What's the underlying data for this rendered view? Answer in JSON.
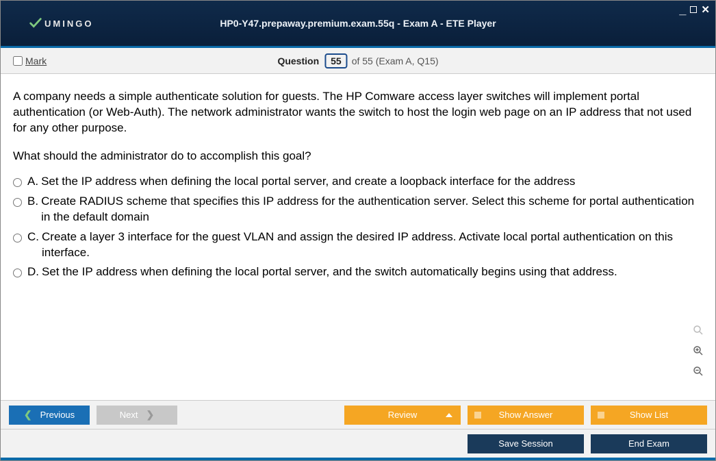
{
  "window": {
    "logo_text": "UMINGO",
    "title": "HP0-Y47.prepaway.premium.exam.55q - Exam A - ETE Player"
  },
  "header": {
    "mark_label": "Mark",
    "question_label": "Question",
    "current": "55",
    "of_text": "of 55 (Exam A, Q15)"
  },
  "question": {
    "text": "A company needs a simple authenticate solution for guests. The HP Comware access layer switches will implement portal authentication (or Web-Auth). The network administrator wants the switch to host the login web page on an IP address that not used for any other purpose.",
    "prompt": "What should the administrator do to accomplish this goal?",
    "options": [
      {
        "letter": "A.",
        "text": "Set the IP address when defining the local portal server, and create a loopback interface for the address"
      },
      {
        "letter": "B.",
        "text": "Create RADIUS scheme that specifies this IP address for the authentication server. Select this scheme for portal authentication in the default domain"
      },
      {
        "letter": "C.",
        "text": "Create a layer 3 interface for the guest VLAN and assign the desired IP address. Activate local portal authentication on this interface."
      },
      {
        "letter": "D.",
        "text": "Set the IP address when defining the local portal server, and the switch automatically begins using that address."
      }
    ]
  },
  "toolbar": {
    "previous": "Previous",
    "next": "Next",
    "review": "Review",
    "show_answer": "Show Answer",
    "show_list": "Show List",
    "save_session": "Save Session",
    "end_exam": "End Exam"
  }
}
